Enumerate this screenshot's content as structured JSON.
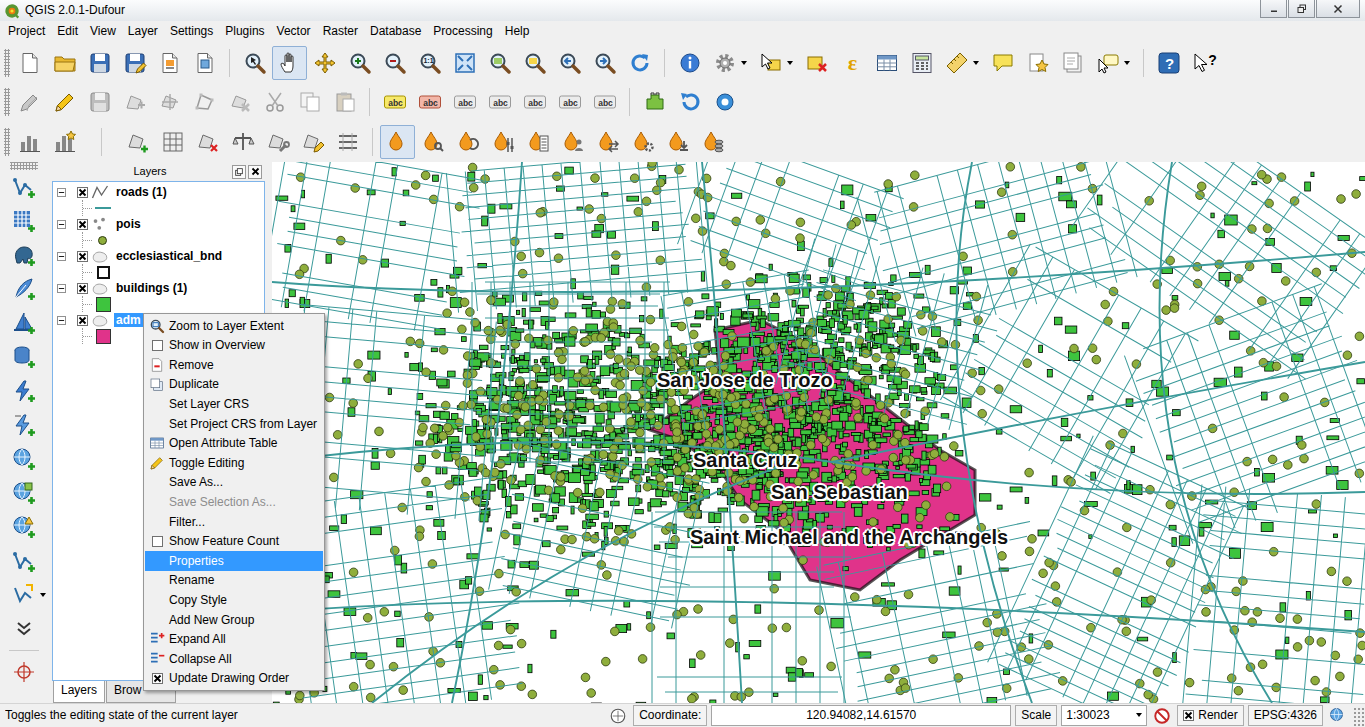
{
  "window": {
    "title": "QGIS 2.0.1-Dufour"
  },
  "menu": [
    "Project",
    "Edit",
    "View",
    "Layer",
    "Settings",
    "Plugins",
    "Vector",
    "Raster",
    "Database",
    "Processing",
    "Help"
  ],
  "toolbars": [
    {
      "buttons": [
        {
          "pressed": false
        },
        {
          "pressed": false
        },
        {
          "pressed": false
        },
        {
          "pressed": false
        },
        {
          "pressed": false
        },
        {
          "pressed": false
        },
        {
          "pressed": false
        },
        {
          "pressed": true
        },
        {
          "pressed": false
        },
        {
          "pressed": false
        },
        {
          "pressed": false
        },
        {
          "pressed": false,
          "text": "1:1"
        },
        {
          "pressed": false
        },
        {
          "pressed": false
        },
        {
          "pressed": false
        },
        {
          "pressed": false
        },
        {
          "pressed": false
        },
        {
          "pressed": false
        },
        {
          "pressed": false
        },
        {
          "pressed": false
        },
        {
          "pressed": false
        },
        {
          "pressed": false
        },
        {
          "pressed": false,
          "text": "ε"
        },
        {
          "pressed": false
        },
        {
          "pressed": false
        },
        {
          "pressed": false
        },
        {
          "pressed": false
        },
        {
          "pressed": false
        },
        {
          "pressed": false
        },
        {
          "pressed": false
        },
        {
          "pressed": false,
          "text": "?"
        },
        {
          "pressed": false,
          "text": "?"
        }
      ]
    },
    {
      "buttons": [
        {
          "pressed": false
        },
        {
          "pressed": false
        },
        {
          "pressed": false
        },
        {
          "pressed": false
        },
        {
          "pressed": false
        },
        {
          "pressed": false
        },
        {
          "pressed": false
        },
        {
          "pressed": false
        },
        {
          "pressed": false
        },
        {
          "pressed": false
        },
        {
          "pressed": false,
          "text": "abc"
        },
        {
          "pressed": false,
          "text": "abc"
        },
        {
          "pressed": false,
          "text": "abc"
        },
        {
          "pressed": false,
          "text": "abc"
        },
        {
          "pressed": false,
          "text": "abc"
        },
        {
          "pressed": false,
          "text": "abc"
        },
        {
          "pressed": false,
          "text": "abc"
        },
        {
          "pressed": false
        },
        {
          "pressed": false
        },
        {
          "pressed": false
        }
      ]
    },
    {
      "buttons": [
        {
          "pressed": false
        },
        {
          "pressed": false
        },
        {
          "pressed": false
        },
        {
          "pressed": false
        },
        {
          "pressed": false
        },
        {
          "pressed": false
        },
        {
          "pressed": false
        },
        {
          "pressed": false
        },
        {
          "pressed": false
        },
        {
          "pressed": true
        },
        {
          "pressed": false
        },
        {
          "pressed": false
        },
        {
          "pressed": false
        },
        {
          "pressed": false
        },
        {
          "pressed": false
        },
        {
          "pressed": false
        },
        {
          "pressed": false
        },
        {
          "pressed": false
        },
        {
          "pressed": false
        }
      ]
    }
  ],
  "layers_panel": {
    "title": "Layers",
    "layers": [
      {
        "name": "roads (1)",
        "checked": true,
        "expanded": true,
        "selected": false,
        "kind": "line",
        "color": "#3b9a9a"
      },
      {
        "name": "pois",
        "checked": true,
        "expanded": true,
        "selected": false,
        "kind": "point",
        "color": "#8fae3c"
      },
      {
        "name": "ecclesiastical_bnd",
        "checked": true,
        "expanded": true,
        "selected": false,
        "kind": "outline",
        "color": "#111111"
      },
      {
        "name": "buildings (1)",
        "checked": true,
        "expanded": true,
        "selected": false,
        "kind": "fill",
        "color": "#3ec43e"
      },
      {
        "name": "adm",
        "checked": true,
        "expanded": true,
        "selected": true,
        "kind": "fill",
        "color": "#e0338a"
      }
    ],
    "tabs": [
      {
        "label": "Layers",
        "selected": true
      },
      {
        "label": "Brow",
        "selected": false
      }
    ]
  },
  "context_menu": {
    "items": [
      {
        "label": "Zoom to Layer Extent",
        "kind": "icon",
        "disabled": false,
        "selected": false
      },
      {
        "label": "Show in Overview",
        "kind": "check",
        "checked": false,
        "disabled": false,
        "selected": false
      },
      {
        "label": "Remove",
        "kind": "icon",
        "disabled": false,
        "selected": false
      },
      {
        "label": "Duplicate",
        "kind": "icon",
        "disabled": false,
        "selected": false
      },
      {
        "label": "Set Layer CRS",
        "kind": "plain",
        "disabled": false,
        "selected": false
      },
      {
        "label": "Set Project CRS from Layer",
        "kind": "plain",
        "disabled": false,
        "selected": false
      },
      {
        "label": "Open Attribute Table",
        "kind": "icon",
        "disabled": false,
        "selected": false
      },
      {
        "label": "Toggle Editing",
        "kind": "icon",
        "disabled": false,
        "selected": false
      },
      {
        "label": "Save As...",
        "kind": "plain",
        "disabled": false,
        "selected": false
      },
      {
        "label": "Save Selection As...",
        "kind": "plain",
        "disabled": true,
        "selected": false
      },
      {
        "label": "Filter...",
        "kind": "plain",
        "disabled": false,
        "selected": false
      },
      {
        "label": "Show Feature Count",
        "kind": "check",
        "checked": false,
        "disabled": false,
        "selected": false
      },
      {
        "label": "Properties",
        "kind": "plain",
        "disabled": false,
        "selected": true
      },
      {
        "label": "Rename",
        "kind": "plain",
        "disabled": false,
        "selected": false
      },
      {
        "label": "Copy Style",
        "kind": "plain",
        "disabled": false,
        "selected": false
      },
      {
        "label": "Add New Group",
        "kind": "plain",
        "disabled": false,
        "selected": false
      },
      {
        "label": "Expand All",
        "kind": "icon",
        "disabled": false,
        "selected": false
      },
      {
        "label": "Collapse All",
        "kind": "icon",
        "disabled": false,
        "selected": false
      },
      {
        "label": "Update Drawing Order",
        "kind": "check",
        "checked": true,
        "disabled": false,
        "selected": false
      }
    ]
  },
  "map": {
    "labels": [
      {
        "text": "San Jose de Trozo"
      },
      {
        "text": "Santa Cruz"
      },
      {
        "text": "San Sebastian"
      },
      {
        "text": "Saint Michael and the Archangels"
      }
    ]
  },
  "status_bar": {
    "message": "Toggles the editing state of the current layer",
    "coordinate_label": "Coordinate:",
    "coordinate": "120.94082,14.61570",
    "scale_label": "Scale",
    "scale": "1:30023",
    "render_label": "Render",
    "render_checked": true,
    "crs": "EPSG:4326"
  }
}
